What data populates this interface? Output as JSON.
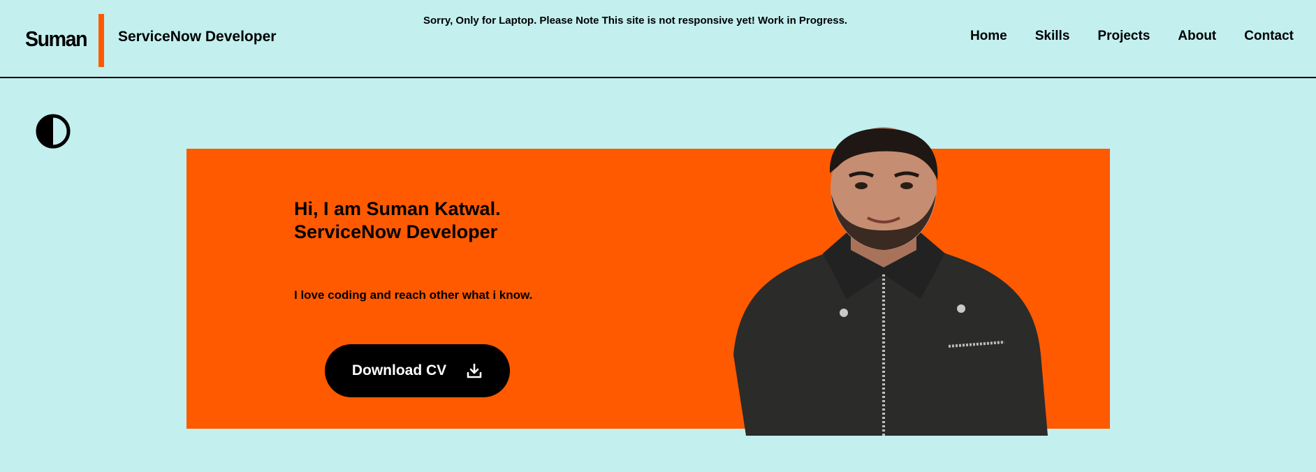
{
  "header": {
    "logo_name": "Suman",
    "logo_role": "ServiceNow Developer",
    "notice": "Sorry, Only for Laptop. Please Note This site is not responsive yet! Work in Progress.",
    "accent_color": "#ff5a00"
  },
  "nav": {
    "items": [
      {
        "label": "Home"
      },
      {
        "label": "Skills"
      },
      {
        "label": "Projects"
      },
      {
        "label": "About"
      },
      {
        "label": "Contact"
      }
    ]
  },
  "theme_toggle": {
    "icon": "contrast-icon"
  },
  "hero": {
    "greeting": "Hi, I am Suman Katwal.",
    "role": "ServiceNow Developer",
    "tagline": "I love coding and reach other what i know.",
    "cv_button": {
      "label": "Download CV",
      "icon": "download-icon"
    },
    "background_color": "#ff5a00",
    "photo_alt": "portrait photo"
  },
  "colors": {
    "page_background": "#c3efef",
    "button_background": "#000000"
  }
}
